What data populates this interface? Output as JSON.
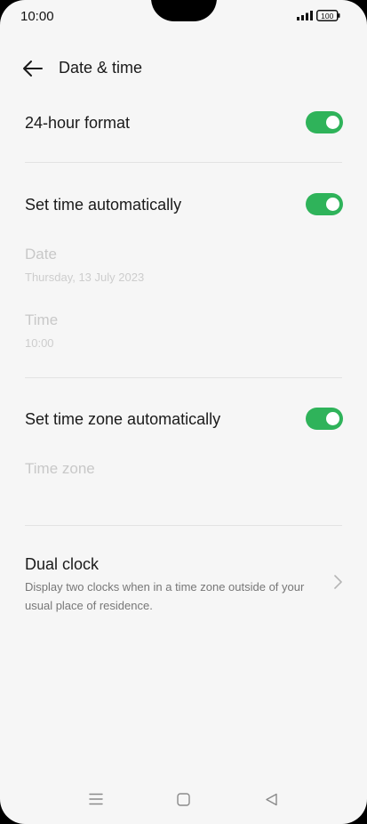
{
  "status_bar": {
    "time": "10:00",
    "battery": "100",
    "icons": [
      "signal-icon",
      "battery-icon"
    ]
  },
  "header": {
    "title": "Date & time",
    "back_icon": "arrow-left-icon"
  },
  "settings": {
    "hour_format": {
      "label": "24-hour format",
      "enabled": true
    },
    "auto_time": {
      "label": "Set time automatically",
      "enabled": true
    },
    "date": {
      "label": "Date",
      "value": "Thursday, 13 July 2023"
    },
    "time": {
      "label": "Time",
      "value": "10:00"
    },
    "auto_timezone": {
      "label": "Set time zone automatically",
      "enabled": true
    },
    "time_zone": {
      "label": "Time zone"
    },
    "dual_clock": {
      "label": "Dual clock",
      "description": "Display two clocks when in a time zone outside of your usual place of residence."
    }
  },
  "colors": {
    "accent": "#2fb35a",
    "background": "#f6f6f6",
    "disabled_text": "#c8c8c8"
  },
  "nav_bar": {
    "icons": [
      "menu-icon",
      "home-icon",
      "back-triangle-icon"
    ]
  }
}
